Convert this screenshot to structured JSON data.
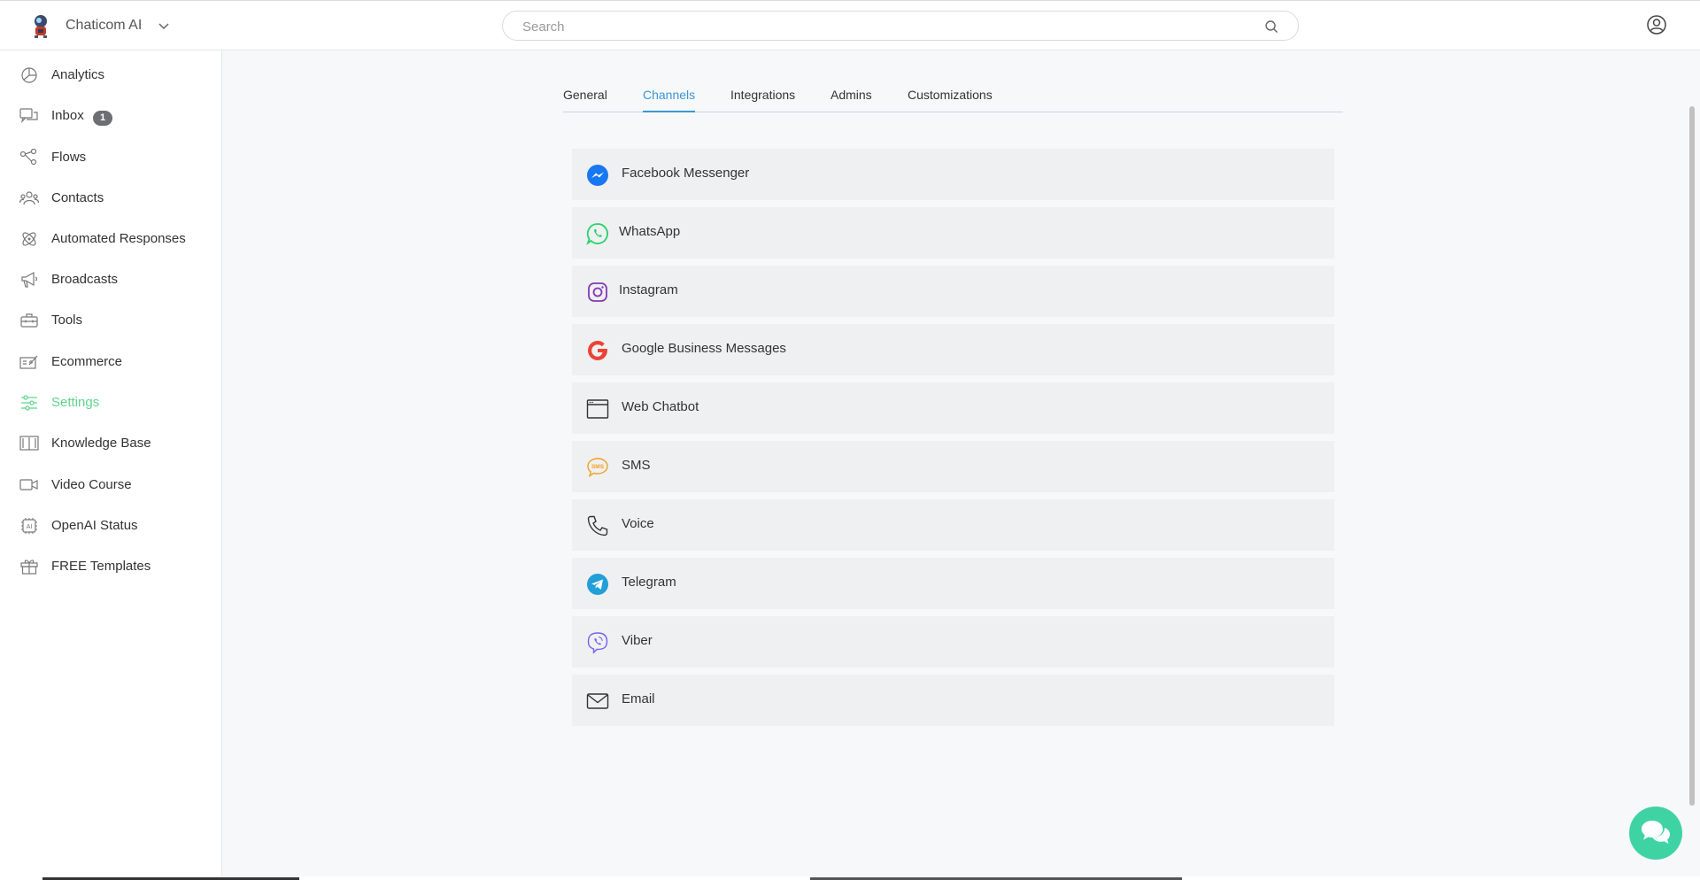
{
  "header": {
    "brand_name": "Chaticom AI",
    "search_placeholder": "Search"
  },
  "sidebar": {
    "items": [
      {
        "label": "Analytics",
        "icon": "analytics-icon"
      },
      {
        "label": "Inbox",
        "icon": "inbox-icon",
        "badge": "1"
      },
      {
        "label": "Flows",
        "icon": "flows-icon"
      },
      {
        "label": "Contacts",
        "icon": "contacts-icon"
      },
      {
        "label": "Automated Responses",
        "icon": "automated-responses-icon"
      },
      {
        "label": "Broadcasts",
        "icon": "megaphone-icon"
      },
      {
        "label": "Tools",
        "icon": "toolbox-icon"
      },
      {
        "label": "Ecommerce",
        "icon": "ecommerce-icon"
      },
      {
        "label": "Settings",
        "icon": "settings-sliders-icon",
        "active": true
      },
      {
        "label": "Knowledge Base",
        "icon": "book-icon"
      },
      {
        "label": "Video Course",
        "icon": "video-icon"
      },
      {
        "label": "OpenAI Status",
        "icon": "ai-chip-icon"
      },
      {
        "label": "FREE Templates",
        "icon": "gift-icon"
      }
    ],
    "active_color": "#5fd38d"
  },
  "tabs": [
    {
      "label": "General"
    },
    {
      "label": "Channels",
      "active": true
    },
    {
      "label": "Integrations"
    },
    {
      "label": "Admins"
    },
    {
      "label": "Customizations"
    }
  ],
  "channels": [
    {
      "label": "Facebook Messenger",
      "icon": "messenger-icon"
    },
    {
      "label": "WhatsApp",
      "icon": "whatsapp-icon"
    },
    {
      "label": "Instagram",
      "icon": "instagram-icon"
    },
    {
      "label": "Google Business Messages",
      "icon": "google-icon"
    },
    {
      "label": "Web Chatbot",
      "icon": "browser-window-icon"
    },
    {
      "label": "SMS",
      "icon": "sms-icon",
      "icon_text": "SMS"
    },
    {
      "label": "Voice",
      "icon": "phone-icon"
    },
    {
      "label": "Telegram",
      "icon": "telegram-icon"
    },
    {
      "label": "Viber",
      "icon": "viber-icon"
    },
    {
      "label": "Email",
      "icon": "envelope-icon"
    }
  ],
  "colors": {
    "tab_active": "#3a97d4",
    "chat_fab": "#3fd3a4",
    "messenger": "#1877f2",
    "whatsapp": "#25d366",
    "instagram": "#833ab4",
    "google": "#ea4335",
    "sms": "#f0a020",
    "telegram": "#229ed9",
    "viber": "#7360f2"
  }
}
